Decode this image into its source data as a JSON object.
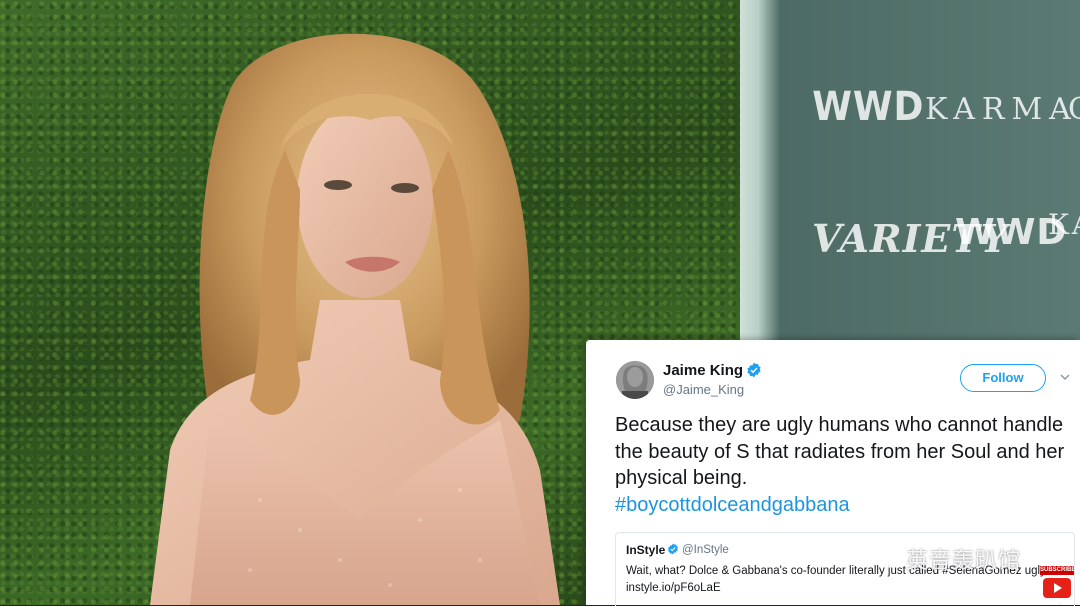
{
  "backdrop": {
    "logos": [
      "WWD",
      "KARMA",
      "VARIETY",
      "WWD",
      "KA",
      "C"
    ]
  },
  "tweet": {
    "name": "Jaime King",
    "handle": "@Jaime_King",
    "verified": true,
    "follow_label": "Follow",
    "text": "Because they are ugly humans who cannot handle the beauty of S that radiates from her Soul and her physical being.",
    "hashtag": "#boycottdolceandgabbana",
    "quoted": {
      "name": "InStyle",
      "handle": "@InStyle",
      "verified": true,
      "text": "Wait, what? Dolce & Gabbana's co-founder literally just called #SelenaGomez ugly",
      "link": "instyle.io/pF6oLaE"
    }
  },
  "watermark": {
    "text": "英音轰趴馆",
    "subscribe_label": "SUBSCRIBE"
  },
  "colors": {
    "twitter_blue": "#1da1f2",
    "hashtag_blue": "#1b95e0",
    "text_dark": "#14171a",
    "text_gray": "#657786"
  }
}
